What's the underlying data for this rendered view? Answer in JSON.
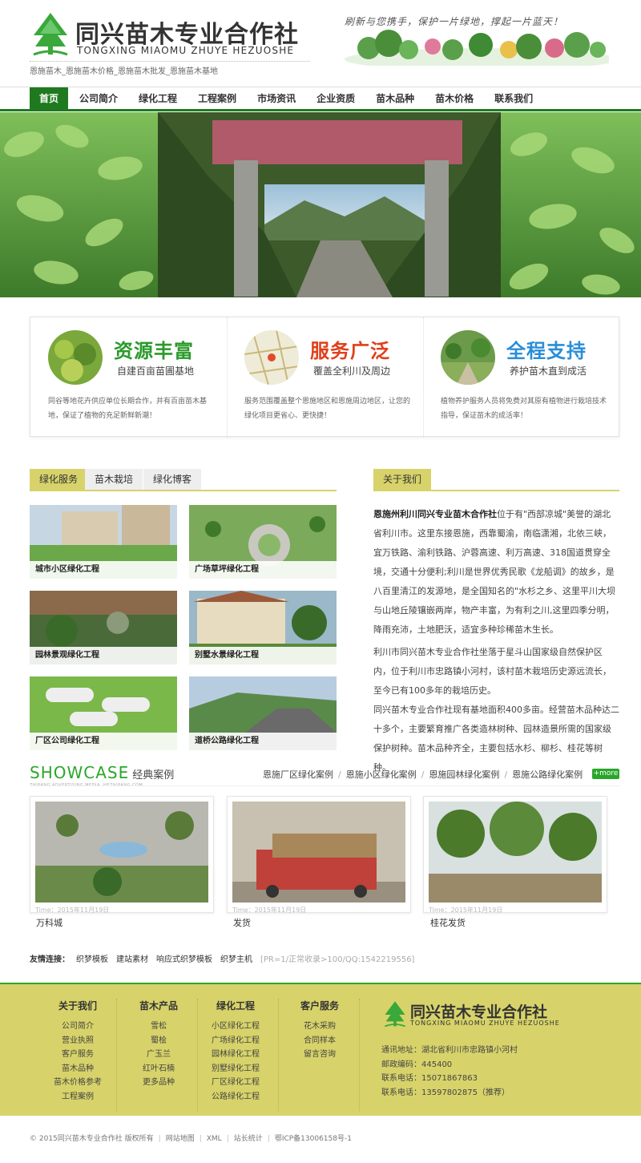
{
  "header": {
    "logo_cn": "同兴苗木专业合作社",
    "logo_en": "TONGXING MIAOMU ZHUYE HEZUOSHE",
    "slogan": "刷新与您携手，保护一片绿地，撑起一片蓝天！",
    "keywords": "恩施苗木_恩施苗木价格_恩施苗木批发_恩施苗木基地"
  },
  "nav": {
    "items": [
      "首页",
      "公司简介",
      "绿化工程",
      "工程案例",
      "市场资讯",
      "企业资质",
      "苗木品种",
      "苗木价格",
      "联系我们"
    ],
    "active": 0
  },
  "features": [
    {
      "title": "资源丰富",
      "subtitle": "自建百亩苗圃基地",
      "desc": "同谷等地花卉供应单位长期合作，并有百亩苗木基地，保证了植物的充足新鲜新潮！",
      "color": "#2a9a2a"
    },
    {
      "title": "服务广泛",
      "subtitle": "覆盖全利川及周边",
      "desc": "服务范围覆盖整个恩施地区和恩施周边地区，让您的绿化项目更省心、更快捷！",
      "color": "#e0401a"
    },
    {
      "title": "全程支持",
      "subtitle": "养护苗木直到成活",
      "desc": "植物养护服务人员将免费对其原有植物进行栽培技术指导，保证苗木的成活率！",
      "color": "#2a8ed8"
    }
  ],
  "tabs": [
    "绿化服务",
    "苗木栽培",
    "绿化博客"
  ],
  "grid": [
    "城市小区绿化工程",
    "广场草坪绿化工程",
    "园林景观绿化工程",
    "别墅水景绿化工程",
    "厂区公司绿化工程",
    "道桥公路绿化工程"
  ],
  "about": {
    "tab": "关于我们",
    "company": "恩施州利川同兴专业苗木合作社",
    "p1": "位于有\"西部凉城\"美誉的湖北省利川市。这里东接恩施，西靠蜀渝，南临潇湘，北依三峡，宜万铁路、渝利铁路、沪蓉高速、利万高速、318国道贯穿全境，交通十分便利;利川是世界优秀民歌《龙船调》的故乡，是八百里清江的发源地，是全国知名的\"水杉之乡、这里平川大坝与山地丘陵镶嵌两岸，物产丰富，为有利之川,这里四季分明，降雨充沛，土地肥沃，适宜多种珍稀苗木生长。",
    "p2": "利川市同兴苗木专业合作社坐落于星斗山国家级自然保护区内，位于利川市忠路镇小河村，该村苗木栽培历史源远流长，至今已有100多年的栽培历史。",
    "p3": "同兴苗木专业合作社现有基地面积400多亩。经营苗木品种达二十多个，主要繁育推广各类造林树种、园林造景所需的国家级保护树种。苗木品种齐全，主要包括水杉、柳杉、桂花等树种。"
  },
  "showcase": {
    "title_en": "SHOWCASE",
    "title_cn": "经典案例",
    "tagline": "ZHIPANG ADVERTISING MEDIA. HEZHIPANG.COM",
    "links": [
      "恩施厂区绿化案例",
      "恩施小区绿化案例",
      "恩施园林绿化案例",
      "恩施公路绿化案例"
    ],
    "more": "+more",
    "cards": [
      {
        "title": "万科城",
        "time": "Time：2015年11月19日"
      },
      {
        "title": "发货",
        "time": "Time：2015年11月19日"
      },
      {
        "title": "桂花发货",
        "time": "Time：2015年11月19日"
      }
    ]
  },
  "friend_links": {
    "label": "友情连接：",
    "items": [
      "织梦模板",
      "建站素材",
      "响应式织梦模板",
      "织梦主机"
    ],
    "note": "[PR=1/正常收录>100/QQ:1542219556]"
  },
  "footer": {
    "columns": [
      {
        "title": "关于我们",
        "items": [
          "公司简介",
          "营业执照",
          "客户服务",
          "苗木品种",
          "苗木价格参考",
          "工程案例"
        ]
      },
      {
        "title": "苗木产品",
        "items": [
          "雪松",
          "蜀桧",
          "广玉兰",
          "红叶石楠",
          "更多品种"
        ]
      },
      {
        "title": "绿化工程",
        "items": [
          "小区绿化工程",
          "广场绿化工程",
          "园林绿化工程",
          "别墅绿化工程",
          "厂区绿化工程",
          "公路绿化工程"
        ]
      },
      {
        "title": "客户服务",
        "items": [
          "花木采购",
          "合同样本",
          "留言咨询"
        ]
      }
    ],
    "logo_cn": "同兴苗木专业合作社",
    "logo_en": "TONGXING MIAOMU ZHUYE HEZUOSHE",
    "address": "通讯地址：湖北省利川市忠路镇小河村",
    "zip": "邮政编码：445400",
    "phone1": "联系电话：15071867863",
    "phone2": "联系电话：13597802875（推荐）"
  },
  "copyright": {
    "items": [
      "© 2015同兴苗木专业合作社 版权所有",
      "网站地图",
      "XML",
      "站长统计",
      "鄂ICP备13006158号-1"
    ]
  }
}
